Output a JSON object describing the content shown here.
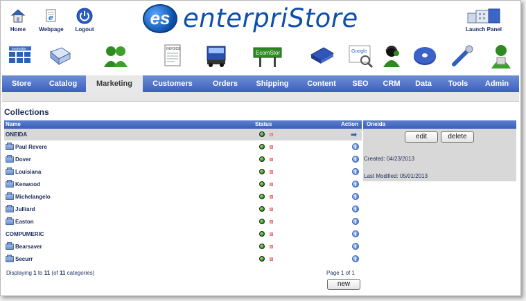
{
  "header": {
    "topnav": [
      {
        "label": "Home",
        "icon": "home-icon"
      },
      {
        "label": "Webpage",
        "icon": "webpage-icon"
      },
      {
        "label": "Logout",
        "icon": "power-icon"
      }
    ],
    "logo_badge": "es",
    "logo_text": "enterpriStore",
    "launch_label": "Launch Panel"
  },
  "icon_row": [
    {
      "name": "ecomstor-grid-icon",
      "caption": "ecomstor"
    },
    {
      "name": "catalog-icon",
      "caption": ""
    },
    {
      "name": "customers-icon",
      "caption": ""
    },
    {
      "name": "invoice-icon",
      "caption": "INVOICE"
    },
    {
      "name": "shipping-truck-icon",
      "caption": ""
    },
    {
      "name": "ecomstor-sign-icon",
      "caption": "EcomStor"
    },
    {
      "name": "data-book-icon",
      "caption": ""
    },
    {
      "name": "google-search-icon",
      "caption": "Google"
    },
    {
      "name": "crm-support-icon",
      "caption": ""
    },
    {
      "name": "disc-icon",
      "caption": ""
    },
    {
      "name": "tools-wrench-icon",
      "caption": ""
    },
    {
      "name": "admin-user-icon",
      "caption": ""
    }
  ],
  "tabs": [
    "Store",
    "Catalog",
    "Marketing",
    "Customers",
    "Orders",
    "Shipping",
    "Content",
    "SEO",
    "CRM",
    "Data",
    "Tools",
    "Admin"
  ],
  "active_tab": "Marketing",
  "page_title": "Collections",
  "table": {
    "headers": {
      "name": "Name",
      "status": "Status",
      "action": "Action"
    },
    "rows": [
      {
        "name": "ONEIDA",
        "folder": false,
        "selected": true
      },
      {
        "name": "Paul Revere",
        "folder": true
      },
      {
        "name": "Dover",
        "folder": true
      },
      {
        "name": "Louisiana",
        "folder": true
      },
      {
        "name": "Kenwood",
        "folder": true
      },
      {
        "name": "Michelangelo",
        "folder": true
      },
      {
        "name": "Julliard",
        "folder": true
      },
      {
        "name": "Easton",
        "folder": true
      },
      {
        "name": "COMPUMERIC",
        "folder": false
      },
      {
        "name": "Bearsaver",
        "folder": true
      },
      {
        "name": "Securr",
        "folder": true
      }
    ],
    "footer": {
      "prefix": "Displaying ",
      "from": "1",
      "to_word": " to ",
      "to": "11",
      "of_prefix": " (of ",
      "total": "11",
      "suffix": " categories)",
      "page": "Page 1 of 1"
    },
    "new_button": "new"
  },
  "panel": {
    "title": "Oneida",
    "edit_button": "edit",
    "delete_button": "delete",
    "created": "Created: 04/23/2013",
    "modified": "Last Modified: 05/01/2013"
  },
  "colors": {
    "tab_bar": "#4a6fc8",
    "status_on": "#3da01c",
    "status_off": "#f0a8a8",
    "logo": "#0e4fa8"
  }
}
